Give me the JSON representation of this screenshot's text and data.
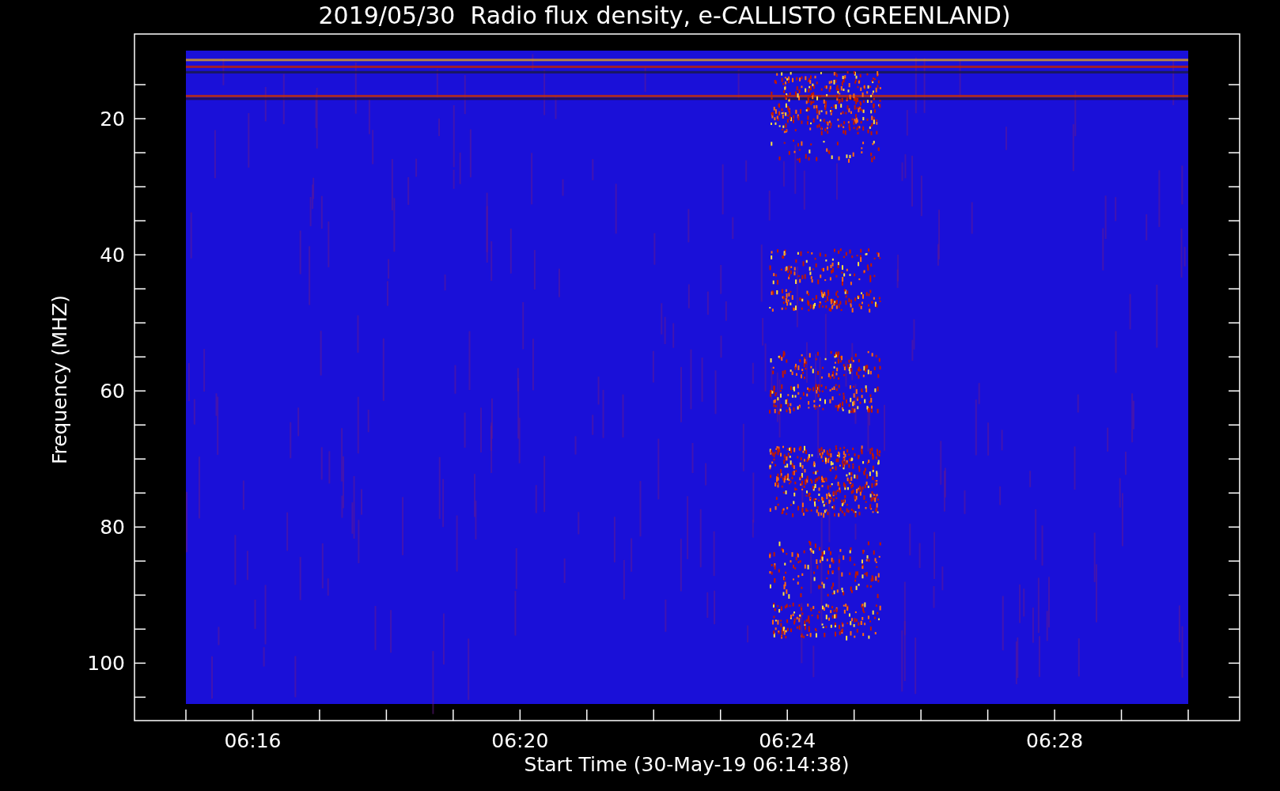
{
  "plot": {
    "title": "2019/05/30  Radio flux density, e-CALLISTO (GREENLAND)",
    "ylabel": "Frequency (MHZ)",
    "xlabel": "Start Time (30-May-19 06:14:38)",
    "y_tick_labels": [
      "20",
      "40",
      "60",
      "80",
      "100"
    ],
    "x_tick_labels": [
      "06:16",
      "06:20",
      "06:24",
      "06:28"
    ]
  }
}
